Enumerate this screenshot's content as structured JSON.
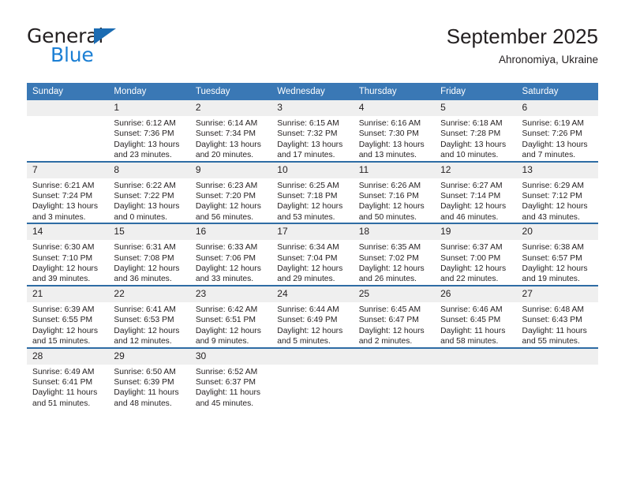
{
  "brand": {
    "name_dark": "General",
    "name_light": "Blue",
    "triangle_color": "#1b6cb3",
    "blue_text_color": "#1b7fd4"
  },
  "header": {
    "title": "September 2025",
    "subtitle": "Ahronomiya, Ukraine"
  },
  "theme": {
    "header_bg": "#3a78b5",
    "row_divider": "#2e6ca4",
    "daynum_bg": "#efefef",
    "text": "#231f20"
  },
  "calendar": {
    "weekday_headers": [
      "Sunday",
      "Monday",
      "Tuesday",
      "Wednesday",
      "Thursday",
      "Friday",
      "Saturday"
    ],
    "labels": {
      "sunrise": "Sunrise:",
      "sunset": "Sunset:",
      "daylight": "Daylight:"
    },
    "weeks": [
      [
        {
          "day": "",
          "lines": []
        },
        {
          "day": "1",
          "lines": [
            "Sunrise: 6:12 AM",
            "Sunset: 7:36 PM",
            "Daylight: 13 hours",
            "and 23 minutes."
          ]
        },
        {
          "day": "2",
          "lines": [
            "Sunrise: 6:14 AM",
            "Sunset: 7:34 PM",
            "Daylight: 13 hours",
            "and 20 minutes."
          ]
        },
        {
          "day": "3",
          "lines": [
            "Sunrise: 6:15 AM",
            "Sunset: 7:32 PM",
            "Daylight: 13 hours",
            "and 17 minutes."
          ]
        },
        {
          "day": "4",
          "lines": [
            "Sunrise: 6:16 AM",
            "Sunset: 7:30 PM",
            "Daylight: 13 hours",
            "and 13 minutes."
          ]
        },
        {
          "day": "5",
          "lines": [
            "Sunrise: 6:18 AM",
            "Sunset: 7:28 PM",
            "Daylight: 13 hours",
            "and 10 minutes."
          ]
        },
        {
          "day": "6",
          "lines": [
            "Sunrise: 6:19 AM",
            "Sunset: 7:26 PM",
            "Daylight: 13 hours",
            "and 7 minutes."
          ]
        }
      ],
      [
        {
          "day": "7",
          "lines": [
            "Sunrise: 6:21 AM",
            "Sunset: 7:24 PM",
            "Daylight: 13 hours",
            "and 3 minutes."
          ]
        },
        {
          "day": "8",
          "lines": [
            "Sunrise: 6:22 AM",
            "Sunset: 7:22 PM",
            "Daylight: 13 hours",
            "and 0 minutes."
          ]
        },
        {
          "day": "9",
          "lines": [
            "Sunrise: 6:23 AM",
            "Sunset: 7:20 PM",
            "Daylight: 12 hours",
            "and 56 minutes."
          ]
        },
        {
          "day": "10",
          "lines": [
            "Sunrise: 6:25 AM",
            "Sunset: 7:18 PM",
            "Daylight: 12 hours",
            "and 53 minutes."
          ]
        },
        {
          "day": "11",
          "lines": [
            "Sunrise: 6:26 AM",
            "Sunset: 7:16 PM",
            "Daylight: 12 hours",
            "and 50 minutes."
          ]
        },
        {
          "day": "12",
          "lines": [
            "Sunrise: 6:27 AM",
            "Sunset: 7:14 PM",
            "Daylight: 12 hours",
            "and 46 minutes."
          ]
        },
        {
          "day": "13",
          "lines": [
            "Sunrise: 6:29 AM",
            "Sunset: 7:12 PM",
            "Daylight: 12 hours",
            "and 43 minutes."
          ]
        }
      ],
      [
        {
          "day": "14",
          "lines": [
            "Sunrise: 6:30 AM",
            "Sunset: 7:10 PM",
            "Daylight: 12 hours",
            "and 39 minutes."
          ]
        },
        {
          "day": "15",
          "lines": [
            "Sunrise: 6:31 AM",
            "Sunset: 7:08 PM",
            "Daylight: 12 hours",
            "and 36 minutes."
          ]
        },
        {
          "day": "16",
          "lines": [
            "Sunrise: 6:33 AM",
            "Sunset: 7:06 PM",
            "Daylight: 12 hours",
            "and 33 minutes."
          ]
        },
        {
          "day": "17",
          "lines": [
            "Sunrise: 6:34 AM",
            "Sunset: 7:04 PM",
            "Daylight: 12 hours",
            "and 29 minutes."
          ]
        },
        {
          "day": "18",
          "lines": [
            "Sunrise: 6:35 AM",
            "Sunset: 7:02 PM",
            "Daylight: 12 hours",
            "and 26 minutes."
          ]
        },
        {
          "day": "19",
          "lines": [
            "Sunrise: 6:37 AM",
            "Sunset: 7:00 PM",
            "Daylight: 12 hours",
            "and 22 minutes."
          ]
        },
        {
          "day": "20",
          "lines": [
            "Sunrise: 6:38 AM",
            "Sunset: 6:57 PM",
            "Daylight: 12 hours",
            "and 19 minutes."
          ]
        }
      ],
      [
        {
          "day": "21",
          "lines": [
            "Sunrise: 6:39 AM",
            "Sunset: 6:55 PM",
            "Daylight: 12 hours",
            "and 15 minutes."
          ]
        },
        {
          "day": "22",
          "lines": [
            "Sunrise: 6:41 AM",
            "Sunset: 6:53 PM",
            "Daylight: 12 hours",
            "and 12 minutes."
          ]
        },
        {
          "day": "23",
          "lines": [
            "Sunrise: 6:42 AM",
            "Sunset: 6:51 PM",
            "Daylight: 12 hours",
            "and 9 minutes."
          ]
        },
        {
          "day": "24",
          "lines": [
            "Sunrise: 6:44 AM",
            "Sunset: 6:49 PM",
            "Daylight: 12 hours",
            "and 5 minutes."
          ]
        },
        {
          "day": "25",
          "lines": [
            "Sunrise: 6:45 AM",
            "Sunset: 6:47 PM",
            "Daylight: 12 hours",
            "and 2 minutes."
          ]
        },
        {
          "day": "26",
          "lines": [
            "Sunrise: 6:46 AM",
            "Sunset: 6:45 PM",
            "Daylight: 11 hours",
            "and 58 minutes."
          ]
        },
        {
          "day": "27",
          "lines": [
            "Sunrise: 6:48 AM",
            "Sunset: 6:43 PM",
            "Daylight: 11 hours",
            "and 55 minutes."
          ]
        }
      ],
      [
        {
          "day": "28",
          "lines": [
            "Sunrise: 6:49 AM",
            "Sunset: 6:41 PM",
            "Daylight: 11 hours",
            "and 51 minutes."
          ]
        },
        {
          "day": "29",
          "lines": [
            "Sunrise: 6:50 AM",
            "Sunset: 6:39 PM",
            "Daylight: 11 hours",
            "and 48 minutes."
          ]
        },
        {
          "day": "30",
          "lines": [
            "Sunrise: 6:52 AM",
            "Sunset: 6:37 PM",
            "Daylight: 11 hours",
            "and 45 minutes."
          ]
        },
        {
          "day": "",
          "lines": []
        },
        {
          "day": "",
          "lines": []
        },
        {
          "day": "",
          "lines": []
        },
        {
          "day": "",
          "lines": []
        }
      ]
    ]
  }
}
